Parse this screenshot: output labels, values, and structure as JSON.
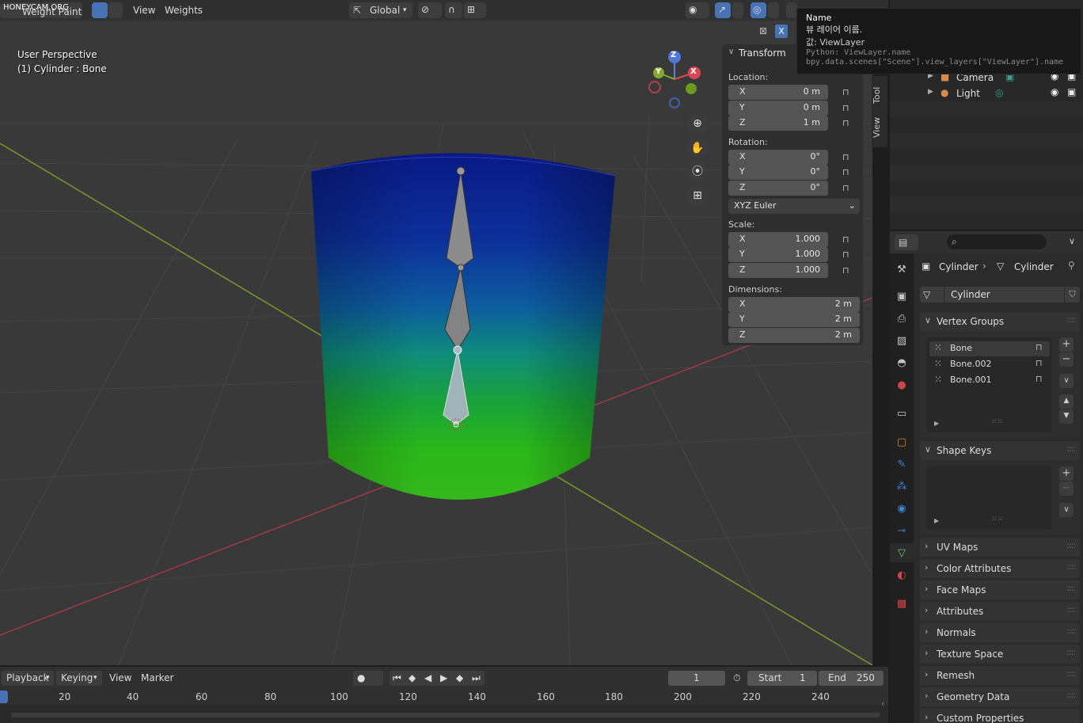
{
  "watermark": "HONEYCAM.ORG",
  "header": {
    "mode_label": "Weight Paint",
    "menu": [
      "View",
      "Weights"
    ],
    "orientation": "Global"
  },
  "viewport": {
    "perspective": "User Perspective",
    "object_info": "(1) Cylinder : Bone",
    "gizmo_axes": {
      "x": "X",
      "y": "Y",
      "z": "Z"
    }
  },
  "npanel": {
    "title": "Transform",
    "location_label": "Location:",
    "location": [
      {
        "axis": "X",
        "value": "0 m"
      },
      {
        "axis": "Y",
        "value": "0 m"
      },
      {
        "axis": "Z",
        "value": "1 m"
      }
    ],
    "rotation_label": "Rotation:",
    "rotation": [
      {
        "axis": "X",
        "value": "0°"
      },
      {
        "axis": "Y",
        "value": "0°"
      },
      {
        "axis": "Z",
        "value": "0°"
      }
    ],
    "rotation_mode": "XYZ Euler",
    "scale_label": "Scale:",
    "scale": [
      {
        "axis": "X",
        "value": "1.000"
      },
      {
        "axis": "Y",
        "value": "1.000"
      },
      {
        "axis": "Z",
        "value": "1.000"
      }
    ],
    "dimensions_label": "Dimensions:",
    "dimensions": [
      {
        "axis": "X",
        "value": "2 m"
      },
      {
        "axis": "Y",
        "value": "2 m"
      },
      {
        "axis": "Z",
        "value": "2 m"
      }
    ],
    "tabs": [
      "Tool",
      "View"
    ]
  },
  "tooltip": {
    "title": "Name",
    "desc": "뷰 레이어 이름.",
    "value": "값: ViewLayer",
    "python1": "Python: ViewLayer.name",
    "python2": "bpy.data.scenes[\"Scene\"].view_layers[\"ViewLayer\"].name"
  },
  "outliner": {
    "items": [
      "Camera",
      "Light"
    ]
  },
  "properties": {
    "breadcrumb": [
      "Cylinder",
      "Cylinder"
    ],
    "mesh_name": "Cylinder",
    "vertex_groups_title": "Vertex Groups",
    "vertex_groups": [
      "Bone",
      "Bone.002",
      "Bone.001"
    ],
    "shape_keys_title": "Shape Keys",
    "collapsed_panels": [
      "UV Maps",
      "Color Attributes",
      "Face Maps",
      "Attributes",
      "Normals",
      "Texture Space",
      "Remesh",
      "Geometry Data",
      "Custom Properties"
    ]
  },
  "timeline": {
    "menu": [
      "Playback",
      "Keying",
      "View",
      "Marker"
    ],
    "current_frame": "1",
    "start_label": "Start",
    "start": "1",
    "end_label": "End",
    "end": "250",
    "ruler": [
      "20",
      "40",
      "60",
      "80",
      "100",
      "120",
      "140",
      "160",
      "180",
      "200",
      "220",
      "240"
    ]
  }
}
